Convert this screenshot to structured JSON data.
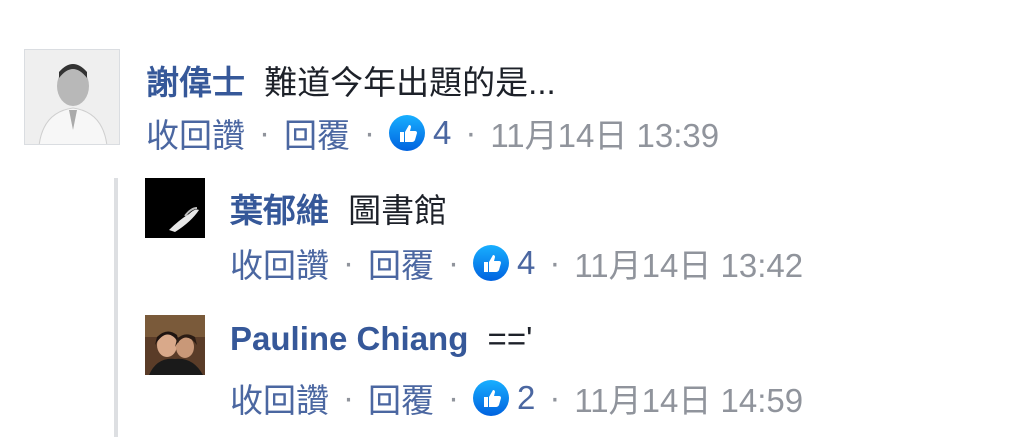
{
  "comments": [
    {
      "author": "謝偉士",
      "text": "難道今年出題的是...",
      "actions": {
        "unlike": "收回讚",
        "reply": "回覆"
      },
      "likes": "4",
      "timestamp": "11月14日 13:39"
    },
    {
      "author": "葉郁維",
      "text": "圖書館",
      "actions": {
        "unlike": "收回讚",
        "reply": "回覆"
      },
      "likes": "4",
      "timestamp": "11月14日 13:42"
    },
    {
      "author": "Pauline Chiang",
      "text": "=='",
      "actions": {
        "unlike": "收回讚",
        "reply": "回覆"
      },
      "likes": "2",
      "timestamp": "11月14日 14:59"
    }
  ],
  "separator": "·",
  "colors": {
    "name": "#365899",
    "link": "#4b67a1",
    "meta": "#90949c",
    "like_icon": "#1877f2"
  }
}
